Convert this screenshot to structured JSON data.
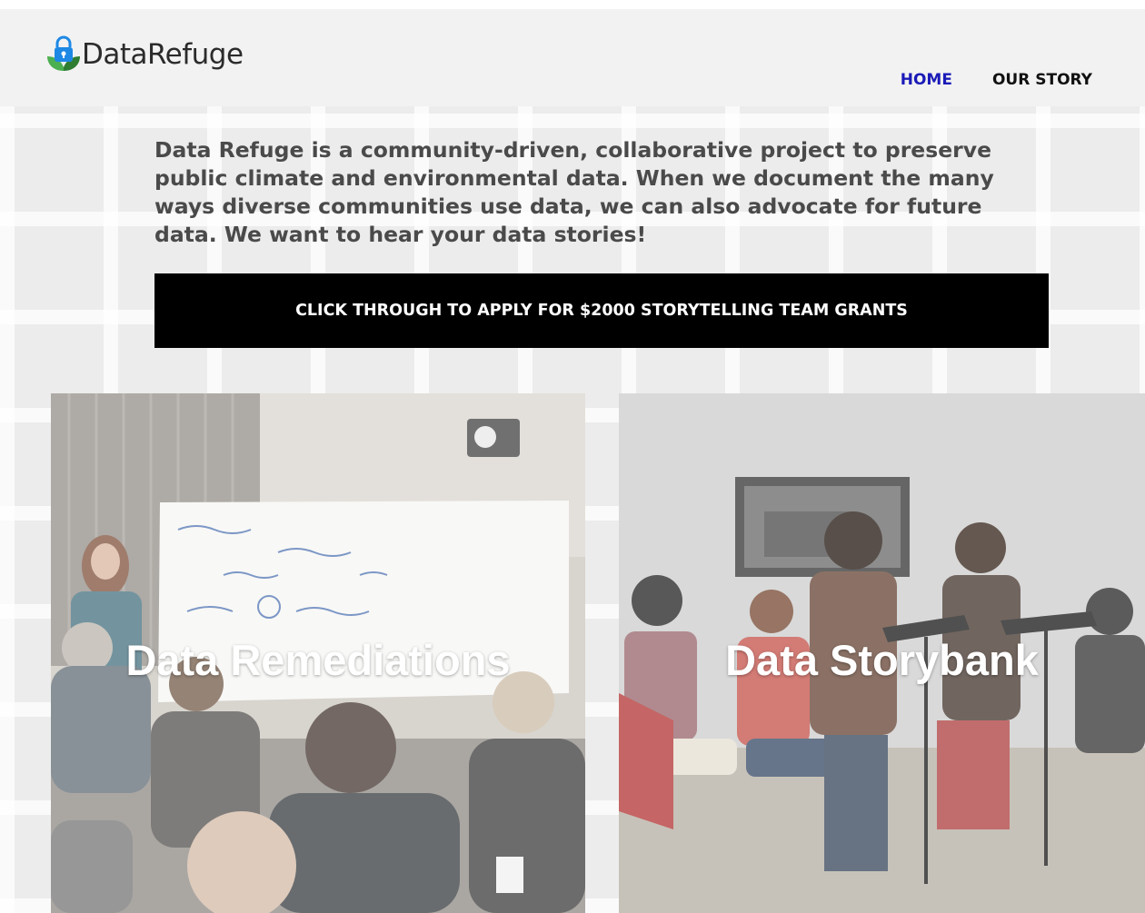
{
  "site": {
    "logo_text": "DataRefuge",
    "logo_icon": "lock-leaf-icon"
  },
  "nav": {
    "items": [
      {
        "label": "HOME",
        "active": true
      },
      {
        "label": "OUR STORY",
        "active": false
      }
    ],
    "active_color": "#1b1bb8"
  },
  "intro": {
    "text": "Data Refuge is a community-driven, collaborative project to preserve public climate and environmental data. When we document the many ways diverse communities use data, we can also advocate for future data. We want to hear your data stories!"
  },
  "cta": {
    "label": "CLICK THROUGH TO APPLY FOR $2000 STORYTELLING TEAM GRANTS"
  },
  "cards": [
    {
      "title": "Data Remediations",
      "image": "workshop-photo"
    },
    {
      "title": "Data Storybank",
      "image": "performance-photo"
    }
  ]
}
